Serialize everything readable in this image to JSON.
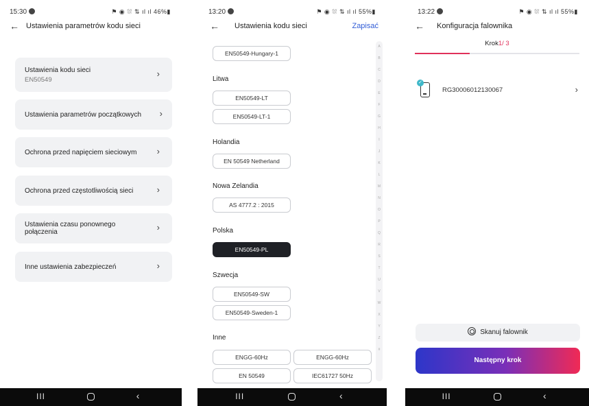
{
  "screen1": {
    "status": {
      "time": "15:30",
      "right": "⚑ ◉ ⛆ ⇅ ıl ıl 46%▮"
    },
    "title": "Ustawienia parametrów kodu sieci",
    "cards": [
      {
        "label": "Ustawienia kodu sieci",
        "sub": "EN50549"
      },
      {
        "label": "Ustawienia parametrów początkowych"
      },
      {
        "label": "Ochrona przed napięciem sieciowym"
      },
      {
        "label": "Ochrona przed częstotliwością sieci"
      },
      {
        "label": "Ustawienia czasu ponownego połączenia"
      },
      {
        "label": "Inne ustawienia zabezpieczeń"
      }
    ]
  },
  "screen2": {
    "status": {
      "time": "13:20",
      "right": "⚑ ◉ ⛆ ⇅ ıl ıl 55%▮"
    },
    "title": "Ustawienia kodu sieci",
    "save": "Zapisać",
    "top_chip": "EN50549-Hungary-1",
    "groups": [
      {
        "name": "Litwa",
        "chips": [
          "EN50549-LT",
          "EN50549-LT-1"
        ]
      },
      {
        "name": "Holandia",
        "chips": [
          "EN 50549 Netherland"
        ]
      },
      {
        "name": "Nowa Zelandia",
        "chips": [
          "AS 4777.2 : 2015"
        ]
      },
      {
        "name": "Polska",
        "chips": [
          "EN50549-PL"
        ]
      },
      {
        "name": "Szwecja",
        "chips": [
          "EN50549-SW",
          "EN50549-Sweden-1"
        ]
      },
      {
        "name": "Inne",
        "chips": [
          "ENGG-60Hz",
          "ENGG-60Hz",
          "EN 50549",
          "IEC61727 50Hz"
        ]
      }
    ],
    "alphabet": [
      "A",
      "B",
      "C",
      "D",
      "E",
      "F",
      "G",
      "H",
      "I",
      "J",
      "K",
      "L",
      "M",
      "N",
      "O",
      "P",
      "Q",
      "R",
      "S",
      "T",
      "U",
      "V",
      "W",
      "X",
      "Y",
      "Z",
      "#"
    ]
  },
  "screen3": {
    "status": {
      "time": "13:22",
      "right": "⚑ ◉ ⛆ ⇅ ıl ıl 55%▮"
    },
    "title": "Konfiguracja falownika",
    "step_prefix": "Krok",
    "step_current": "1",
    "step_total": "/ 3",
    "step_progress": 0.333,
    "device_sn": "RG30006012130067",
    "scan_label": "Skanuj falownik",
    "next_label": "Następny krok"
  },
  "nav": {
    "recent": "III",
    "back": "‹"
  },
  "colors": {
    "accent": "#e0305a",
    "link": "#2f5bd6",
    "selected_chip": "#1f2126",
    "gradient_start": "#2d36c9",
    "gradient_end": "#f02a55"
  }
}
